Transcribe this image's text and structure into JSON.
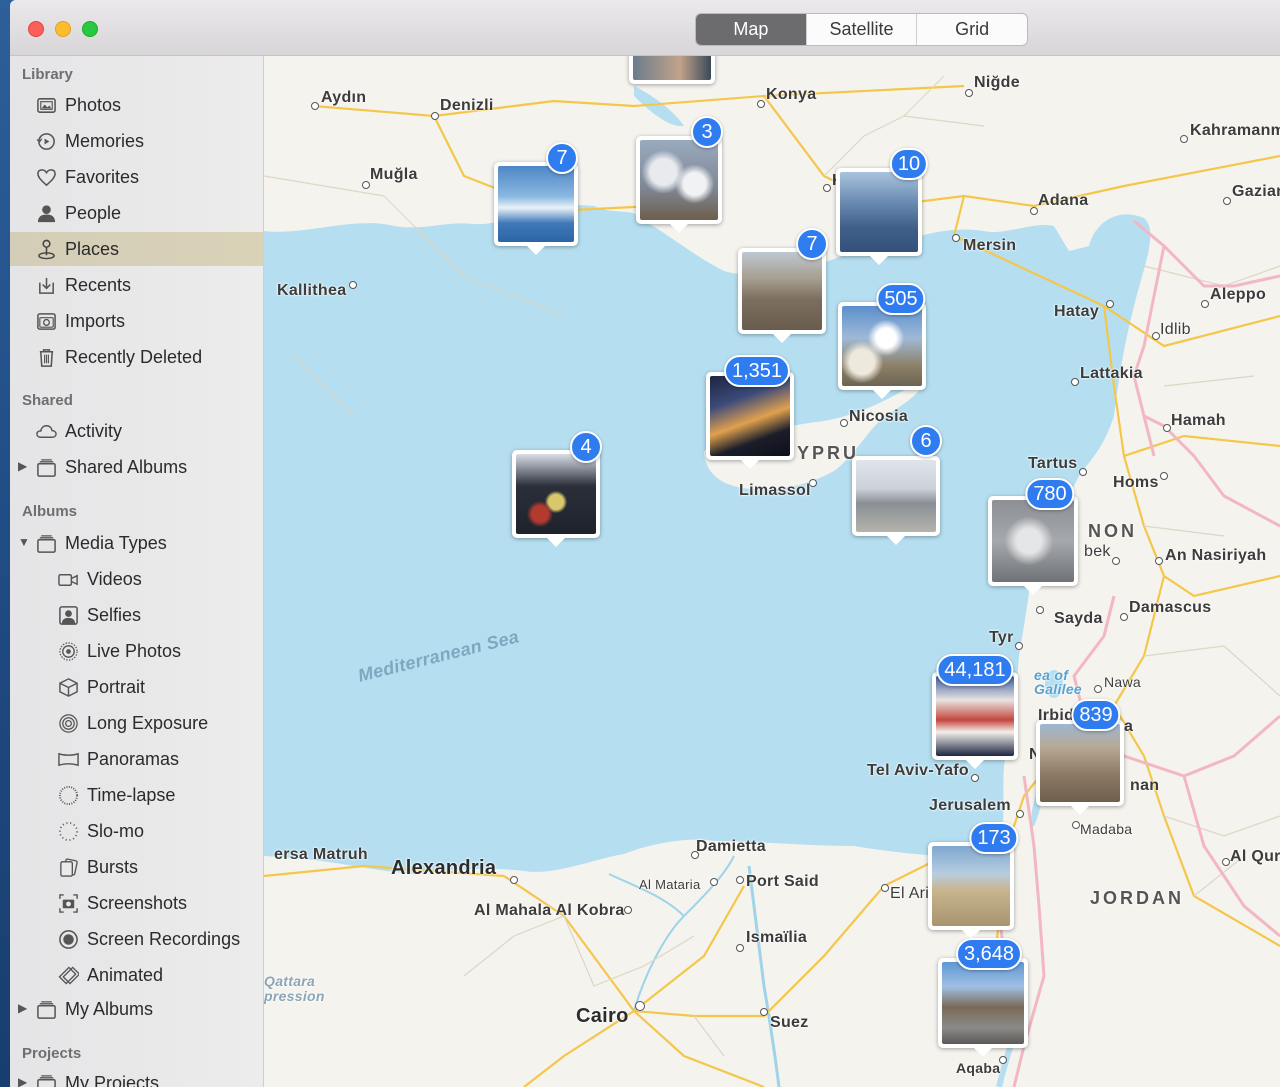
{
  "segmented": {
    "map": "Map",
    "satellite": "Satellite",
    "grid": "Grid",
    "active": "Map"
  },
  "sidebar": {
    "library_header": "Library",
    "library": [
      {
        "label": "Photos",
        "icon": "photos-icon"
      },
      {
        "label": "Memories",
        "icon": "memories-icon"
      },
      {
        "label": "Favorites",
        "icon": "heart-icon"
      },
      {
        "label": "People",
        "icon": "person-icon"
      },
      {
        "label": "Places",
        "icon": "pin-icon",
        "selected": true
      },
      {
        "label": "Recents",
        "icon": "recents-icon"
      },
      {
        "label": "Imports",
        "icon": "camera-icon"
      },
      {
        "label": "Recently Deleted",
        "icon": "trash-icon"
      }
    ],
    "shared_header": "Shared",
    "shared": [
      {
        "label": "Activity",
        "icon": "cloud-icon"
      },
      {
        "label": "Shared Albums",
        "icon": "folder-icon"
      }
    ],
    "albums_header": "Albums",
    "media_types": "Media Types",
    "media": [
      {
        "label": "Videos",
        "icon": "video-icon"
      },
      {
        "label": "Selfies",
        "icon": "selfie-icon"
      },
      {
        "label": "Live Photos",
        "icon": "live-photo-icon"
      },
      {
        "label": "Portrait",
        "icon": "cube-icon"
      },
      {
        "label": "Long Exposure",
        "icon": "long-exposure-icon"
      },
      {
        "label": "Panoramas",
        "icon": "panorama-icon"
      },
      {
        "label": "Time-lapse",
        "icon": "timelapse-icon"
      },
      {
        "label": "Slo-mo",
        "icon": "slomo-icon"
      },
      {
        "label": "Bursts",
        "icon": "bursts-icon"
      },
      {
        "label": "Screenshots",
        "icon": "screenshot-icon"
      },
      {
        "label": "Screen Recordings",
        "icon": "record-icon"
      },
      {
        "label": "Animated",
        "icon": "animated-icon"
      }
    ],
    "my_albums": "My Albums",
    "projects_header": "Projects",
    "my_projects": "My Projects"
  },
  "map": {
    "sea_label": "Mediterranean Sea",
    "cities": {
      "aydin": "Aydın",
      "denizli": "Denizli",
      "konya": "Konya",
      "nigde": "Niğde",
      "kahramanm": "Kahramanm",
      "mugla": "Muğla",
      "adana": "Adana",
      "gazian": "Gazian",
      "k": "K",
      "mersin": "Mersin",
      "kallithea": "Kallithea",
      "hatay": "Hatay",
      "aleppo": "Aleppo",
      "idlib": "Idlib",
      "lattakia": "Lattakia",
      "nicosia": "Nicosia",
      "hamah": "Hamah",
      "cyprus": "YPRU",
      "tartus": "Tartus",
      "limassol": "Limassol",
      "homs": "Homs",
      "lebanon": "NON",
      "bek": "bek",
      "nasiriyah": "An Nasiriyah",
      "be": "Be",
      "sayda": "Sayda",
      "damascus": "Damascus",
      "tyr": "Tyr",
      "galilee": "ea of Galilee",
      "nawa": "Nawa",
      "irbid": "Irbid",
      "a_partial": "a",
      "nalabel": "N",
      "telaviv": "Tel Aviv-Yafo",
      "amman": "nan",
      "jerusalem": "Jerusalem",
      "madaba": "Madaba",
      "matruh": "ersa Matruh",
      "alexandria": "Alexandria",
      "damietta": "Damietta",
      "alqura": "Al Qura",
      "almataria": "Al Mataria",
      "portsaid": "Port Said",
      "elaris": "El Aris",
      "jordan": "JORDAN",
      "almahala": "Al Mahala Al Kobra",
      "ismailia": "Ismaïlia",
      "qattara": "Qattara pression",
      "cairo": "Cairo",
      "suez": "Suez",
      "aqaba": "Aqaba"
    },
    "clusters": [
      {
        "count": "7",
        "photo": "sky-blue"
      },
      {
        "count": "3",
        "photo": "clouds-aerial"
      },
      {
        "count": "10",
        "photo": "sky-haze"
      },
      {
        "count": "7",
        "photo": "aerial-town"
      },
      {
        "count": "505",
        "photo": "clouds-coast"
      },
      {
        "count": "1,351",
        "photo": "sunset-wing"
      },
      {
        "count": "6",
        "photo": "airport"
      },
      {
        "count": "4",
        "photo": "food-tray"
      },
      {
        "count": "780",
        "photo": "grey-clouds"
      },
      {
        "count": "44,181",
        "photo": "store"
      },
      {
        "count": "839",
        "photo": "desert-aerial"
      },
      {
        "count": "173",
        "photo": "desert"
      },
      {
        "count": "3,648",
        "photo": "mountain-road"
      }
    ]
  }
}
